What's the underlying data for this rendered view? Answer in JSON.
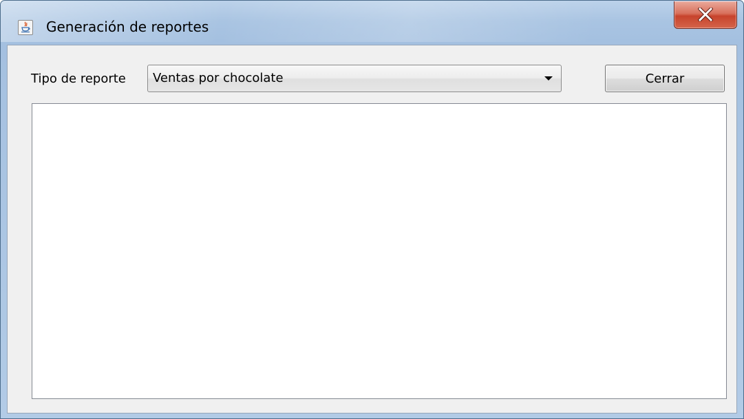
{
  "window": {
    "title": "Generación de reportes",
    "icon": "java-cup-icon",
    "close_icon": "close-icon"
  },
  "form": {
    "report_type_label": "Tipo de reporte",
    "report_type_selected": "Ventas por chocolate",
    "close_button_label": "Cerrar"
  },
  "report_area": {
    "content": ""
  },
  "colors": {
    "titlebar": "#a9c4e2",
    "client_bg": "#f0f0f0",
    "close_button": "#c7432c",
    "report_bg": "#ffffff"
  }
}
